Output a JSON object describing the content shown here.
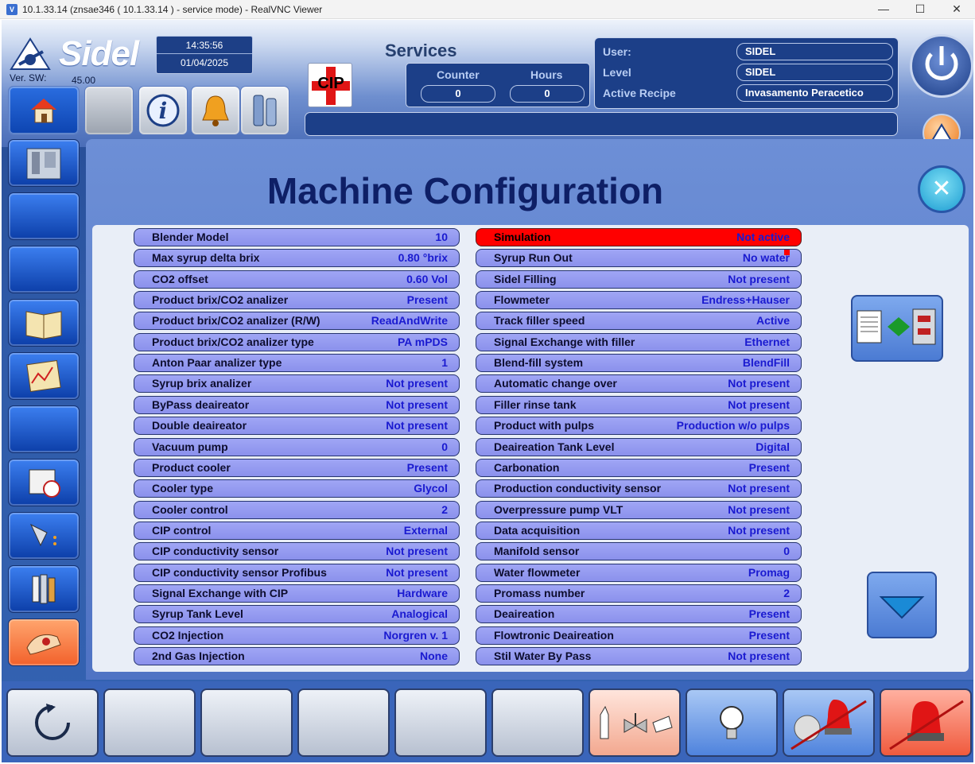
{
  "window": {
    "title": "10.1.33.14 (znsae346 ( 10.1.33.14 ) - service mode) - RealVNC Viewer",
    "controls": [
      "—",
      "☐",
      "✕"
    ]
  },
  "header": {
    "logo_text": "Sidel",
    "version_label": "Ver. SW:",
    "version_value": "45.00",
    "time": "14:35:56",
    "date": "01/04/2025",
    "cip_label": "CIP",
    "services": {
      "title": "Services",
      "counter_label": "Counter",
      "hours_label": "Hours",
      "counter_value": "0",
      "hours_value": "0"
    },
    "user": {
      "user_label": "User:",
      "user_value": "SIDEL",
      "level_label": "Level",
      "level_value": "SIDEL",
      "recipe_label": "Active Recipe",
      "recipe_value": "Invasamento Peracetico"
    }
  },
  "page": {
    "title": "Machine Configuration"
  },
  "left_column": [
    {
      "label": "Blender Model",
      "value": "10"
    },
    {
      "label": "Max syrup delta brix",
      "value": "0.80 °brix"
    },
    {
      "label": "CO2 offset",
      "value": "0.60 Vol"
    },
    {
      "label": "Product brix/CO2 analizer",
      "value": "Present"
    },
    {
      "label": "Product brix/CO2 analizer (R/W)",
      "value": "ReadAndWrite"
    },
    {
      "label": "Product brix/CO2 analizer type",
      "value": "PA mPDS"
    },
    {
      "label": "Anton Paar analizer type",
      "value": "1"
    },
    {
      "label": "Syrup brix analizer",
      "value": "Not present"
    },
    {
      "label": "ByPass deaireator",
      "value": "Not present"
    },
    {
      "label": "Double deaireator",
      "value": "Not present"
    },
    {
      "label": "Vacuum pump",
      "value": "0"
    },
    {
      "label": "Product cooler",
      "value": "Present"
    },
    {
      "label": "Cooler type",
      "value": "Glycol"
    },
    {
      "label": "Cooler control",
      "value": "2"
    },
    {
      "label": "CIP control",
      "value": "External"
    },
    {
      "label": "CIP conductivity sensor",
      "value": "Not present"
    },
    {
      "label": "CIP conductivity sensor Profibus",
      "value": "Not present"
    },
    {
      "label": "Signal Exchange with CIP",
      "value": "Hardware"
    },
    {
      "label": "Syrup Tank Level",
      "value": "Analogical"
    },
    {
      "label": "CO2 Injection",
      "value": "Norgren v. 1"
    },
    {
      "label": "2nd Gas Injection",
      "value": "None"
    }
  ],
  "right_column": [
    {
      "label": "Simulation",
      "value": "Not active"
    },
    {
      "label": "Syrup Run Out",
      "value": "No water"
    },
    {
      "label": "Sidel Filling",
      "value": "Not present"
    },
    {
      "label": "Flowmeter",
      "value": "Endress+Hauser"
    },
    {
      "label": "Track filler speed",
      "value": "Active"
    },
    {
      "label": "Signal Exchange with filler",
      "value": "Ethernet"
    },
    {
      "label": "Blend-fill system",
      "value": "BlendFill"
    },
    {
      "label": "Automatic change over",
      "value": "Not present"
    },
    {
      "label": "Filler rinse tank",
      "value": "Not present"
    },
    {
      "label": "Product with pulps",
      "value": "Production w/o pulps"
    },
    {
      "label": "Deaireation Tank Level",
      "value": "Digital"
    },
    {
      "label": "Carbonation",
      "value": "Present"
    },
    {
      "label": "Production conductivity sensor",
      "value": "Not present"
    },
    {
      "label": "Overpressure pump VLT",
      "value": "Not present"
    },
    {
      "label": "Data acquisition",
      "value": "Not present"
    },
    {
      "label": "Manifold sensor",
      "value": "0"
    },
    {
      "label": "Water flowmeter",
      "value": "Promag"
    },
    {
      "label": "Promass number",
      "value": "2"
    },
    {
      "label": "Deaireation",
      "value": "Present"
    },
    {
      "label": "Flowtronic Deaireation",
      "value": "Present"
    },
    {
      "label": "Stil Water By Pass",
      "value": "Not present"
    }
  ],
  "colors": {
    "row_bg": "#9298ef",
    "value_text": "#1a1ad0",
    "alert_row": "#ff0000",
    "title_text": "#0e1f66"
  }
}
